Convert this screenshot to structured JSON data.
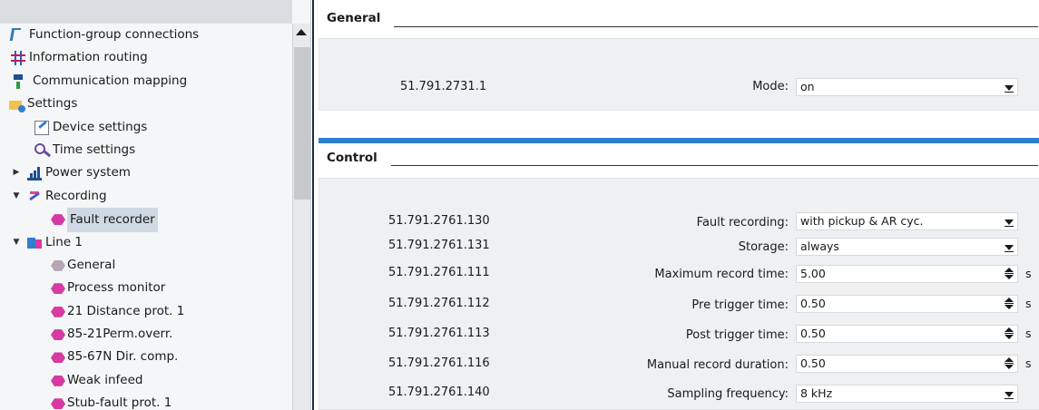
{
  "tree": {
    "items": [
      {
        "label": "Function-group connections",
        "icon": "function-group-icon"
      },
      {
        "label": "Information routing",
        "icon": "grid-routing-icon"
      },
      {
        "label": "Communication mapping",
        "icon": "communication-mapping-icon"
      },
      {
        "label": "Settings",
        "icon": "settings-folder-icon"
      },
      {
        "label": "Device settings",
        "icon": "device-settings-icon"
      },
      {
        "label": "Time settings",
        "icon": "time-settings-icon"
      },
      {
        "label": "Power system",
        "icon": "power-system-icon"
      },
      {
        "label": "Recording",
        "icon": "recording-icon"
      },
      {
        "label": "Fault recorder",
        "icon": "function-hex-icon",
        "selected": true
      },
      {
        "label": "Line 1",
        "icon": "line-icon"
      },
      {
        "label": "General",
        "icon": "function-hex-grey-icon"
      },
      {
        "label": "Process monitor",
        "icon": "function-hex-icon"
      },
      {
        "label": "21 Distance prot. 1",
        "icon": "function-hex-icon"
      },
      {
        "label": "85-21Perm.overr.",
        "icon": "function-hex-icon"
      },
      {
        "label": "85-67N Dir. comp.",
        "icon": "function-hex-icon"
      },
      {
        "label": "Weak infeed",
        "icon": "function-hex-icon"
      },
      {
        "label": "Stub-fault prot. 1",
        "icon": "function-hex-icon"
      }
    ]
  },
  "general": {
    "title": "General",
    "params": [
      {
        "id": "51.791.2731.1",
        "label": "Mode:",
        "value": "on",
        "control": "dropdown"
      }
    ]
  },
  "control": {
    "title": "Control",
    "params": [
      {
        "id": "51.791.2761.130",
        "label": "Fault recording:",
        "value": "with pickup & AR cyc.",
        "control": "dropdown"
      },
      {
        "id": "51.791.2761.131",
        "label": "Storage:",
        "value": "always",
        "control": "dropdown"
      },
      {
        "id": "51.791.2761.111",
        "label": "Maximum record time:",
        "value": "5.00",
        "control": "spinner",
        "unit": "s"
      },
      {
        "id": "51.791.2761.112",
        "label": "Pre trigger time:",
        "value": "0.50",
        "control": "spinner",
        "unit": "s"
      },
      {
        "id": "51.791.2761.113",
        "label": "Post trigger time:",
        "value": "0.50",
        "control": "spinner",
        "unit": "s"
      },
      {
        "id": "51.791.2761.116",
        "label": "Manual record duration:",
        "value": "0.50",
        "control": "spinner",
        "unit": "s"
      },
      {
        "id": "51.791.2761.140",
        "label": "Sampling frequency:",
        "value": "8 kHz",
        "control": "dropdown"
      }
    ]
  },
  "colors": {
    "accent_bar": "#2f7fd1",
    "selection": "#cfd9e3",
    "panel_bg": "#eef0f2"
  }
}
